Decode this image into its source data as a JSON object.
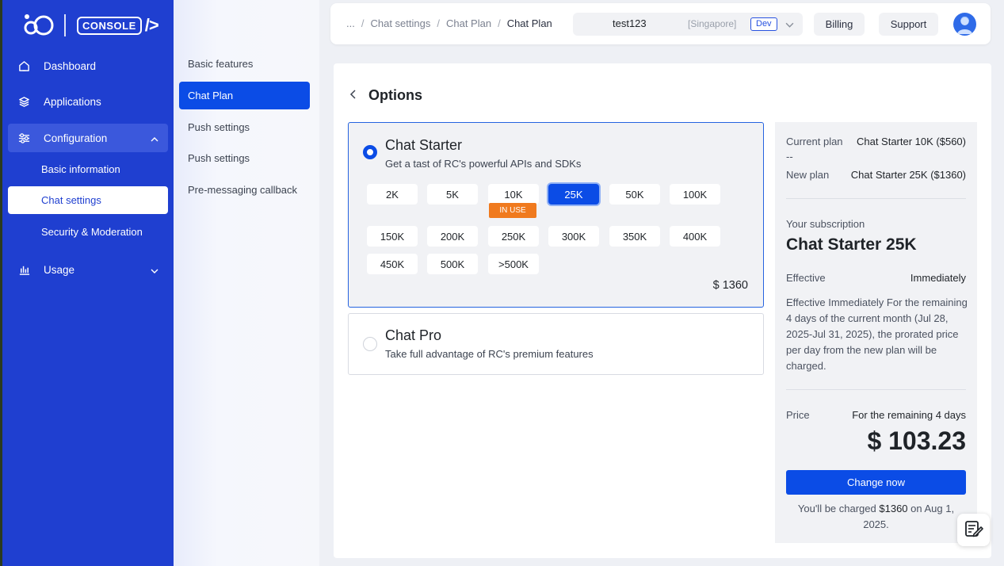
{
  "logo": {
    "text": "CONSOLE",
    "suffix": "/>"
  },
  "sidebar": {
    "items": [
      {
        "label": "Dashboard",
        "icon": "home-icon"
      },
      {
        "label": "Applications",
        "icon": "layers-icon"
      },
      {
        "label": "Configuration",
        "icon": "sliders-icon"
      },
      {
        "label": "Usage",
        "icon": "bar-chart-icon"
      }
    ],
    "config_sub": [
      "Basic information",
      "Chat settings",
      "Security & Moderation"
    ]
  },
  "menu2": [
    "Basic features",
    "Chat Plan",
    "Push settings",
    "Push settings",
    "Pre-messaging callback"
  ],
  "topbar": {
    "breadcrumbs": [
      "...",
      "Chat settings",
      "Chat Plan",
      "Chat Plan"
    ],
    "app_name": "test123",
    "region": "[Singapore]",
    "env": "Dev",
    "billing": "Billing",
    "support": "Support"
  },
  "options": {
    "title": "Options",
    "starter": {
      "name": "Chat Starter",
      "desc": "Get a tast of RC's powerful APIs and SDKs",
      "tiers": [
        "2K",
        "5K",
        "10K",
        "25K",
        "50K",
        "100K",
        "150K",
        "200K",
        "250K",
        "300K",
        "350K",
        "400K",
        "450K",
        "500K",
        ">500K"
      ],
      "selected": "25K",
      "in_use_label": "IN USE",
      "price": "$ 1360"
    },
    "pro": {
      "name": "Chat Pro",
      "desc": "Take full advantage of RC's premium features"
    }
  },
  "summary": {
    "current_plan_label": "Current plan",
    "current_plan_value": "Chat Starter 10K ($560)",
    "dashes": "--",
    "new_plan_label": "New plan",
    "new_plan_value": "Chat Starter 25K ($1360)",
    "subscription_label": "Your subscription",
    "subscription_name": "Chat Starter 25K",
    "effective_label": "Effective",
    "effective_value": "Immediately",
    "note": "Effective Immediately For the remaining 4 days of the current month (Jul 28, 2025-Jul 31, 2025), the prorated price per day from the new plan will be charged.",
    "price_label": "Price",
    "price_period": "For the remaining 4 days",
    "price_value": "$ 103.23",
    "cta": "Change now",
    "charge_prefix": "You'll be charged",
    "charge_amount": "$1360",
    "charge_suffix": "on Aug 1, 2025."
  },
  "colors": {
    "sidebar": "#1f3fd0",
    "accent": "#0b4ce6",
    "in_use": "#f07a1e"
  }
}
